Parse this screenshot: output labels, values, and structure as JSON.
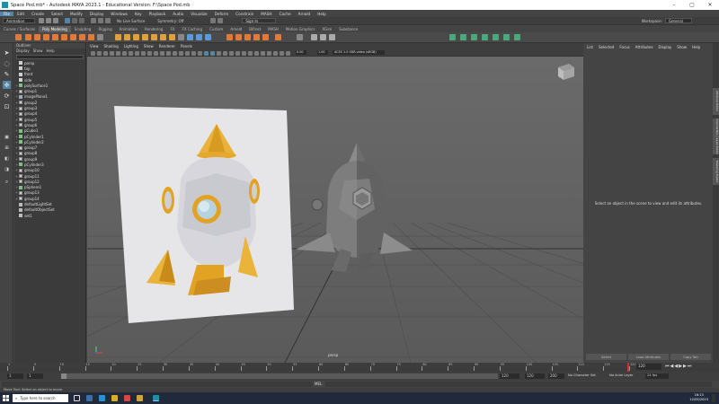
{
  "window": {
    "title": "Space Pod.mb* - Autodesk MAYA 2023.1 - Educational Version: F:\\Space Pod.mb"
  },
  "menubar": [
    "File",
    "Edit",
    "Create",
    "Select",
    "Modify",
    "Display",
    "Windows",
    "Key",
    "Playback",
    "Audio",
    "Visualize",
    "Deform",
    "Constrain",
    "MASH",
    "Cache",
    "Arnold",
    "Help"
  ],
  "workspace": {
    "label": "Workspace:",
    "value": "General"
  },
  "row2": {
    "mode": "Animation",
    "live": "No Live Surface",
    "symmetry": "Symmetry: Off",
    "sign_in": "Sign In"
  },
  "shelf_tabs": [
    "Curves / Surfaces",
    "Poly Modeling",
    "Sculpting",
    "Rigging",
    "Animation",
    "Rendering",
    "FX",
    "FX Caching",
    "Custom",
    "Arnold",
    "Bifrost",
    "MASH",
    "Motion Graphics",
    "XGen",
    "Substance"
  ],
  "active_shelf_tab": "Poly Modeling",
  "outliner": {
    "title": "Outliner",
    "menu": [
      "Display",
      "Show",
      "Help"
    ],
    "items": [
      {
        "name": "persp",
        "type": "camera"
      },
      {
        "name": "top",
        "type": "camera"
      },
      {
        "name": "front",
        "type": "camera"
      },
      {
        "name": "side",
        "type": "camera"
      },
      {
        "name": "polySurface1",
        "type": "mesh",
        "exp": true
      },
      {
        "name": "group1",
        "type": "group",
        "exp": true
      },
      {
        "name": "imagePlane1",
        "type": "plane",
        "exp": true
      },
      {
        "name": "group2",
        "type": "group",
        "exp": true
      },
      {
        "name": "group3",
        "type": "group",
        "exp": true
      },
      {
        "name": "group4",
        "type": "group",
        "exp": true
      },
      {
        "name": "group5",
        "type": "group",
        "exp": true
      },
      {
        "name": "group6",
        "type": "group",
        "exp": true
      },
      {
        "name": "pCube1",
        "type": "mesh",
        "exp": true
      },
      {
        "name": "pCylinder1",
        "type": "mesh",
        "exp": true
      },
      {
        "name": "pCylinder2",
        "type": "mesh",
        "exp": true
      },
      {
        "name": "group7",
        "type": "group",
        "exp": true
      },
      {
        "name": "group8",
        "type": "group",
        "exp": true
      },
      {
        "name": "group9",
        "type": "group",
        "exp": true
      },
      {
        "name": "pCylinder3",
        "type": "mesh",
        "exp": true
      },
      {
        "name": "group10",
        "type": "group",
        "exp": true
      },
      {
        "name": "group11",
        "type": "group",
        "exp": true
      },
      {
        "name": "group12",
        "type": "group",
        "exp": true
      },
      {
        "name": "pSphere1",
        "type": "mesh",
        "exp": true
      },
      {
        "name": "group13",
        "type": "group",
        "exp": true
      },
      {
        "name": "group14",
        "type": "group",
        "exp": true
      },
      {
        "name": "defaultLightSet",
        "type": "set",
        "exp": false
      },
      {
        "name": "defaultObjectSet",
        "type": "set",
        "exp": false
      },
      {
        "name": "set1",
        "type": "set",
        "exp": false
      }
    ]
  },
  "viewport": {
    "menu": [
      "View",
      "Shading",
      "Lighting",
      "Show",
      "Renderer",
      "Panels"
    ],
    "camera_label": "persp",
    "field1": "0.00",
    "field2": "1.00",
    "color_space": "ACES 1.0 SDR-video (sRGB)"
  },
  "attribute_editor": {
    "menu": [
      "List",
      "Selected",
      "Focus",
      "Attributes",
      "Display",
      "Show",
      "Help"
    ],
    "message": "Select an object in the scene to view and edit its attributes.",
    "buttons": [
      "Select",
      "Load Attributes",
      "Copy Tab"
    ],
    "side_tabs": [
      "Attribute Editor",
      "Channel Box / Layer Editor",
      "Modeling Toolkit"
    ]
  },
  "timeline": {
    "ticks": [
      "1",
      "5",
      "10",
      "15",
      "20",
      "25",
      "30",
      "35",
      "40",
      "45",
      "50",
      "55",
      "60",
      "65",
      "70",
      "75",
      "80",
      "85",
      "90",
      "95",
      "100",
      "105",
      "110",
      "115",
      "120"
    ],
    "current": "120"
  },
  "range": {
    "start": "1",
    "start2": "1",
    "end": "120",
    "end2": "120",
    "end3": "200",
    "character_set": "No Character Set",
    "anim_layer": "No Anim Layer",
    "fps": "24 fps"
  },
  "cmdline": {
    "label": "MEL"
  },
  "helpline": {
    "text": "Move Tool: Select an object to move."
  },
  "taskbar": {
    "search_placeholder": "Type here to search",
    "time": "16:13",
    "date": "12/05/2023"
  }
}
